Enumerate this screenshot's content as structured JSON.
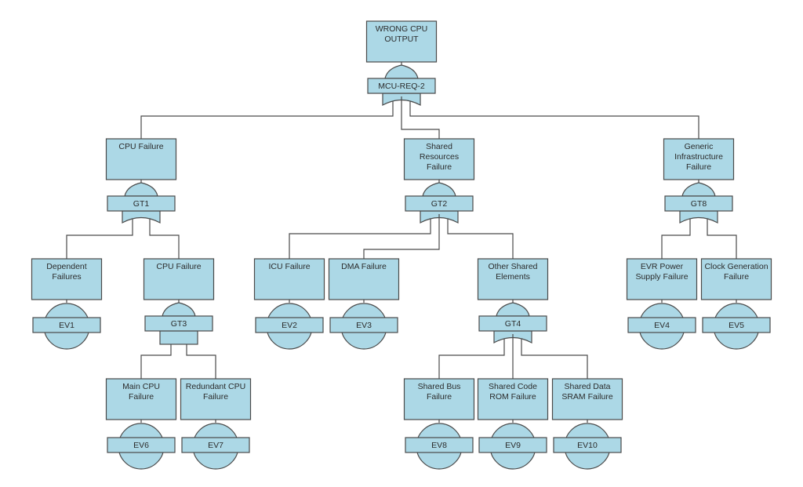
{
  "diagram": {
    "type": "fault-tree",
    "colors": {
      "fill": "#acd8e6",
      "stroke": "#4a4a4a",
      "text": "#2b2b2b",
      "background": "#ffffff"
    },
    "root": {
      "id": "top",
      "label": [
        "WRONG CPU",
        "OUTPUT"
      ],
      "gate": {
        "id": "MCU-REQ-2",
        "type": "OR"
      },
      "children": [
        {
          "id": "cpu-failure",
          "label": [
            "CPU Failure"
          ],
          "gate": {
            "id": "GT1",
            "type": "OR"
          },
          "children": [
            {
              "id": "dependent-failures",
              "label": [
                "Dependent",
                "Failures"
              ],
              "event": "EV1"
            },
            {
              "id": "cpu-failure-2",
              "label": [
                "CPU Failure"
              ],
              "gate": {
                "id": "GT3",
                "type": "AND"
              },
              "children": [
                {
                  "id": "main-cpu-failure",
                  "label": [
                    "Main CPU",
                    "Failure"
                  ],
                  "event": "EV6"
                },
                {
                  "id": "redundant-cpu-failure",
                  "label": [
                    "Redundant CPU",
                    "Failure"
                  ],
                  "event": "EV7"
                }
              ]
            }
          ]
        },
        {
          "id": "shared-resources-failure",
          "label": [
            "Shared",
            "Resources",
            "Failure"
          ],
          "gate": {
            "id": "GT2",
            "type": "OR"
          },
          "children": [
            {
              "id": "icu-failure",
              "label": [
                "ICU Failure"
              ],
              "event": "EV2"
            },
            {
              "id": "dma-failure",
              "label": [
                "DMA Failure"
              ],
              "event": "EV3"
            },
            {
              "id": "other-shared-elements",
              "label": [
                "Other Shared",
                "Elements"
              ],
              "gate": {
                "id": "GT4",
                "type": "OR"
              },
              "children": [
                {
                  "id": "shared-bus-failure",
                  "label": [
                    "Shared Bus",
                    "Failure"
                  ],
                  "event": "EV8"
                },
                {
                  "id": "shared-code-rom-failure",
                  "label": [
                    "Shared Code",
                    "ROM Failure"
                  ],
                  "event": "EV9"
                },
                {
                  "id": "shared-data-sram-failure",
                  "label": [
                    "Shared Data",
                    "SRAM Failure"
                  ],
                  "event": "EV10"
                }
              ]
            }
          ]
        },
        {
          "id": "generic-infrastructure-failure",
          "label": [
            "Generic",
            "Infrastructure",
            "Failure"
          ],
          "gate": {
            "id": "GT8",
            "type": "OR"
          },
          "children": [
            {
              "id": "evr-power-supply-failure",
              "label": [
                "EVR Power",
                "Supply Failure"
              ],
              "event": "EV4"
            },
            {
              "id": "clock-generation-failure",
              "label": [
                "Clock Generation",
                "Failure"
              ],
              "event": "EV5"
            }
          ]
        }
      ]
    }
  }
}
